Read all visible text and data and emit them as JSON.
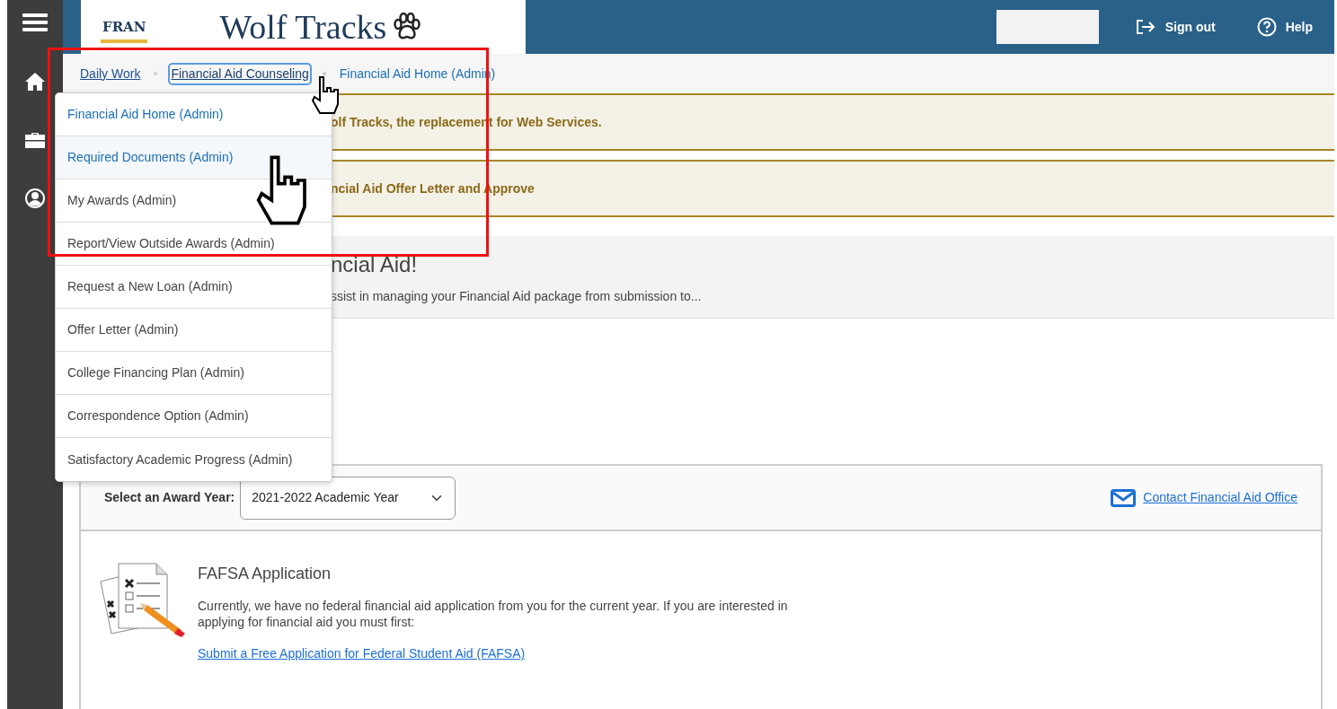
{
  "header": {
    "logo_text": "FRAN",
    "title": "Wolf Tracks",
    "actions": [
      "Sign out",
      "Help"
    ]
  },
  "breadcrumbs": [
    {
      "label": "Daily Work",
      "kind": "link",
      "expanded": false
    },
    {
      "label": "Financial Aid Counseling",
      "kind": "menu",
      "expanded": true
    },
    {
      "label": "Financial Aid Home (Admin)",
      "kind": "current",
      "expanded": false
    }
  ],
  "menu": [
    {
      "label": "Financial Aid Home (Admin)",
      "kind": "current"
    },
    {
      "label": "Required Documents (Admin)",
      "kind": "hovered"
    },
    {
      "label": "My Awards (Admin)",
      "kind": "plain"
    },
    {
      "label": "Report/View Outside Awards (Admin)",
      "kind": "plain"
    },
    {
      "label": "Request a New Loan (Admin)",
      "kind": "plain"
    },
    {
      "label": "Offer Letter (Admin)",
      "kind": "plain"
    },
    {
      "label": "College Financing Plan (Admin)",
      "kind": "plain"
    },
    {
      "label": "Correspondence Option (Admin)",
      "kind": "plain"
    },
    {
      "label": "Satisfactory Academic Progress (Admin)",
      "kind": "plain"
    }
  ],
  "alerts": [
    "olf Tracks, the replacement for Web Services.",
    "ncial Aid Offer Letter and Approve"
  ],
  "hero": {
    "title": "ncial Aid!",
    "subtitle": "ssist in managing your Financial Aid package from submission to..."
  },
  "award_year": {
    "label": "Select an Award Year:",
    "value": "2021-2022 Academic Year",
    "contact_link": "Contact Financial Aid Office"
  },
  "fafsa": {
    "title": "FAFSA Application",
    "text": "Currently, we have no federal financial aid application from you for the current year. If you are interested in applying for financial aid you must first:",
    "link": "Submit a Free Application for Federal Student Aid (FAFSA)"
  }
}
